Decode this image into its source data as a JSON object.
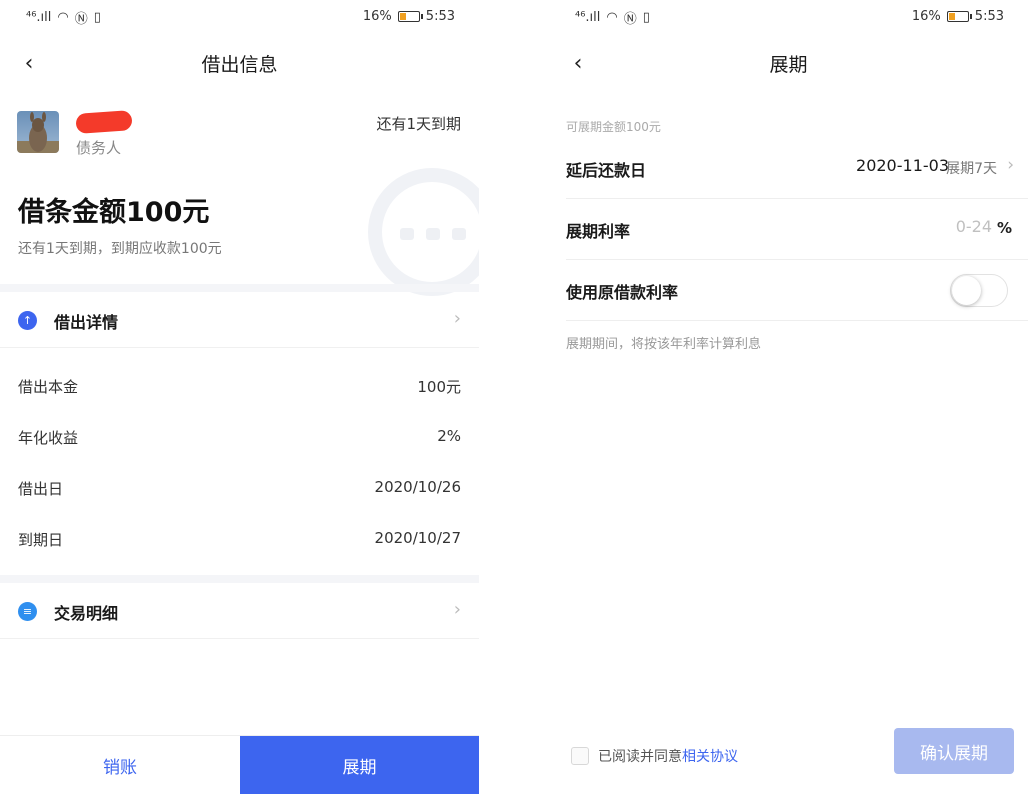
{
  "status": {
    "signal_text": "⁴⁶.ıll",
    "battery_percent": "16%",
    "time": "5:53"
  },
  "left": {
    "nav_title": "借出信息",
    "debtor": {
      "role": "债务人",
      "due_tag": "还有1天到期"
    },
    "amount_title": "借条金额100元",
    "amount_sub": "还有1天到期，到期应收款100元",
    "detail_section": {
      "label": "借出详情"
    },
    "details": [
      {
        "key": "借出本金",
        "value": "100元"
      },
      {
        "key": "年化收益",
        "value": "2%"
      },
      {
        "key": "借出日",
        "value": "2020/10/26"
      },
      {
        "key": "到期日",
        "value": "2020/10/27"
      }
    ],
    "transaction_section": {
      "label": "交易明细"
    },
    "buttons": {
      "write_off": "销账",
      "extend": "展期"
    }
  },
  "right": {
    "nav_title": "展期",
    "hint_top": "可展期金额100元",
    "deferred_date": {
      "label": "延后还款日",
      "date": "2020-11-03",
      "days": "展期7天"
    },
    "extension_rate": {
      "label": "展期利率",
      "placeholder": "0-24",
      "unit": "%"
    },
    "use_original_rate": {
      "label": "使用原借款利率",
      "enabled": false
    },
    "hint_bottom": "展期期间，将按该年利率计算利息",
    "agreement": {
      "prefix": "已阅读并同意",
      "link": "相关协议"
    },
    "confirm_button": "确认展期"
  },
  "colors": {
    "accent": "#3d65ef",
    "accent_disabled": "#a8b9ef",
    "redaction": "#f43a2a"
  }
}
